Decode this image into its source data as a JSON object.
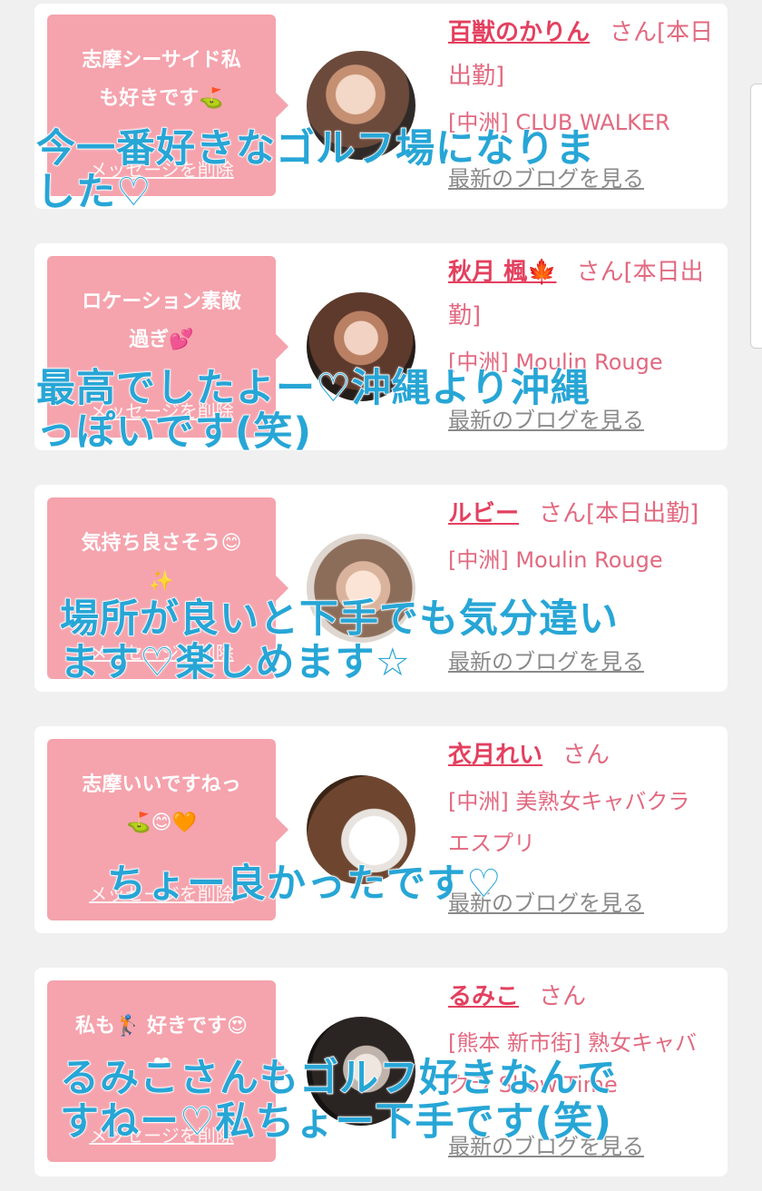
{
  "items": [
    {
      "message_line1": "志摩シーサイド私",
      "message_line2": "も好きです⛳",
      "delete_label": "メッセージを削除",
      "name": "百獣のかりん",
      "suffix": "さん[本日出勤]",
      "shop": "[中洲] CLUB WALKER",
      "blog_link": "最新のブログを見る",
      "caption_line1": "今一番好きなゴルフ場になりま",
      "caption_line2": "した♡"
    },
    {
      "message_line1": "ロケーション素敵",
      "message_line2": "過ぎ💕",
      "delete_label": "メッセージを削除",
      "name": "秋月 楓🍁",
      "suffix": "さん[本日出勤]",
      "shop": "[中洲] Moulin Rouge",
      "blog_link": "最新のブログを見る",
      "caption_line1": "最高でしたよー♡沖縄より沖縄",
      "caption_line2": "っぽいです(笑)"
    },
    {
      "message_line1": "気持ち良さそう😊",
      "message_line2": "✨",
      "delete_label": "メッセージを削除",
      "name": "ルビー",
      "suffix": "さん[本日出勤]",
      "shop": "[中洲] Moulin Rouge",
      "blog_link": "最新のブログを見る",
      "caption_line1": "場所が良いと下手でも気分違い",
      "caption_line2": "ます♡楽しめます☆"
    },
    {
      "message_line1": "志摩いいですねっ",
      "message_line2": "⛳😊🧡",
      "delete_label": "メッセージを削除",
      "name": "衣月れい",
      "suffix": "さん",
      "shop": "[中洲] 美熟女キャバクラ エスプリ",
      "blog_link": "最新のブログを見る",
      "caption_line1": "ちょー良かったです♡",
      "caption_line2": ""
    },
    {
      "message_line1": "私も🏌 好きです😍",
      "message_line2": "❤",
      "delete_label": "メッセージを削除",
      "name": "るみこ",
      "suffix": "さん",
      "shop": "[熊本 新市街] 熟女キャバクラ Show Time",
      "blog_link": "最新のブログを見る",
      "caption_line1": "るみこさんもゴルフ好きなんで",
      "caption_line2": "すねー♡私ちょー下手です(笑)"
    }
  ],
  "colors": {
    "bubble": "#f5a3ad",
    "name": "#e4405f",
    "caption": "#27a6d6"
  }
}
